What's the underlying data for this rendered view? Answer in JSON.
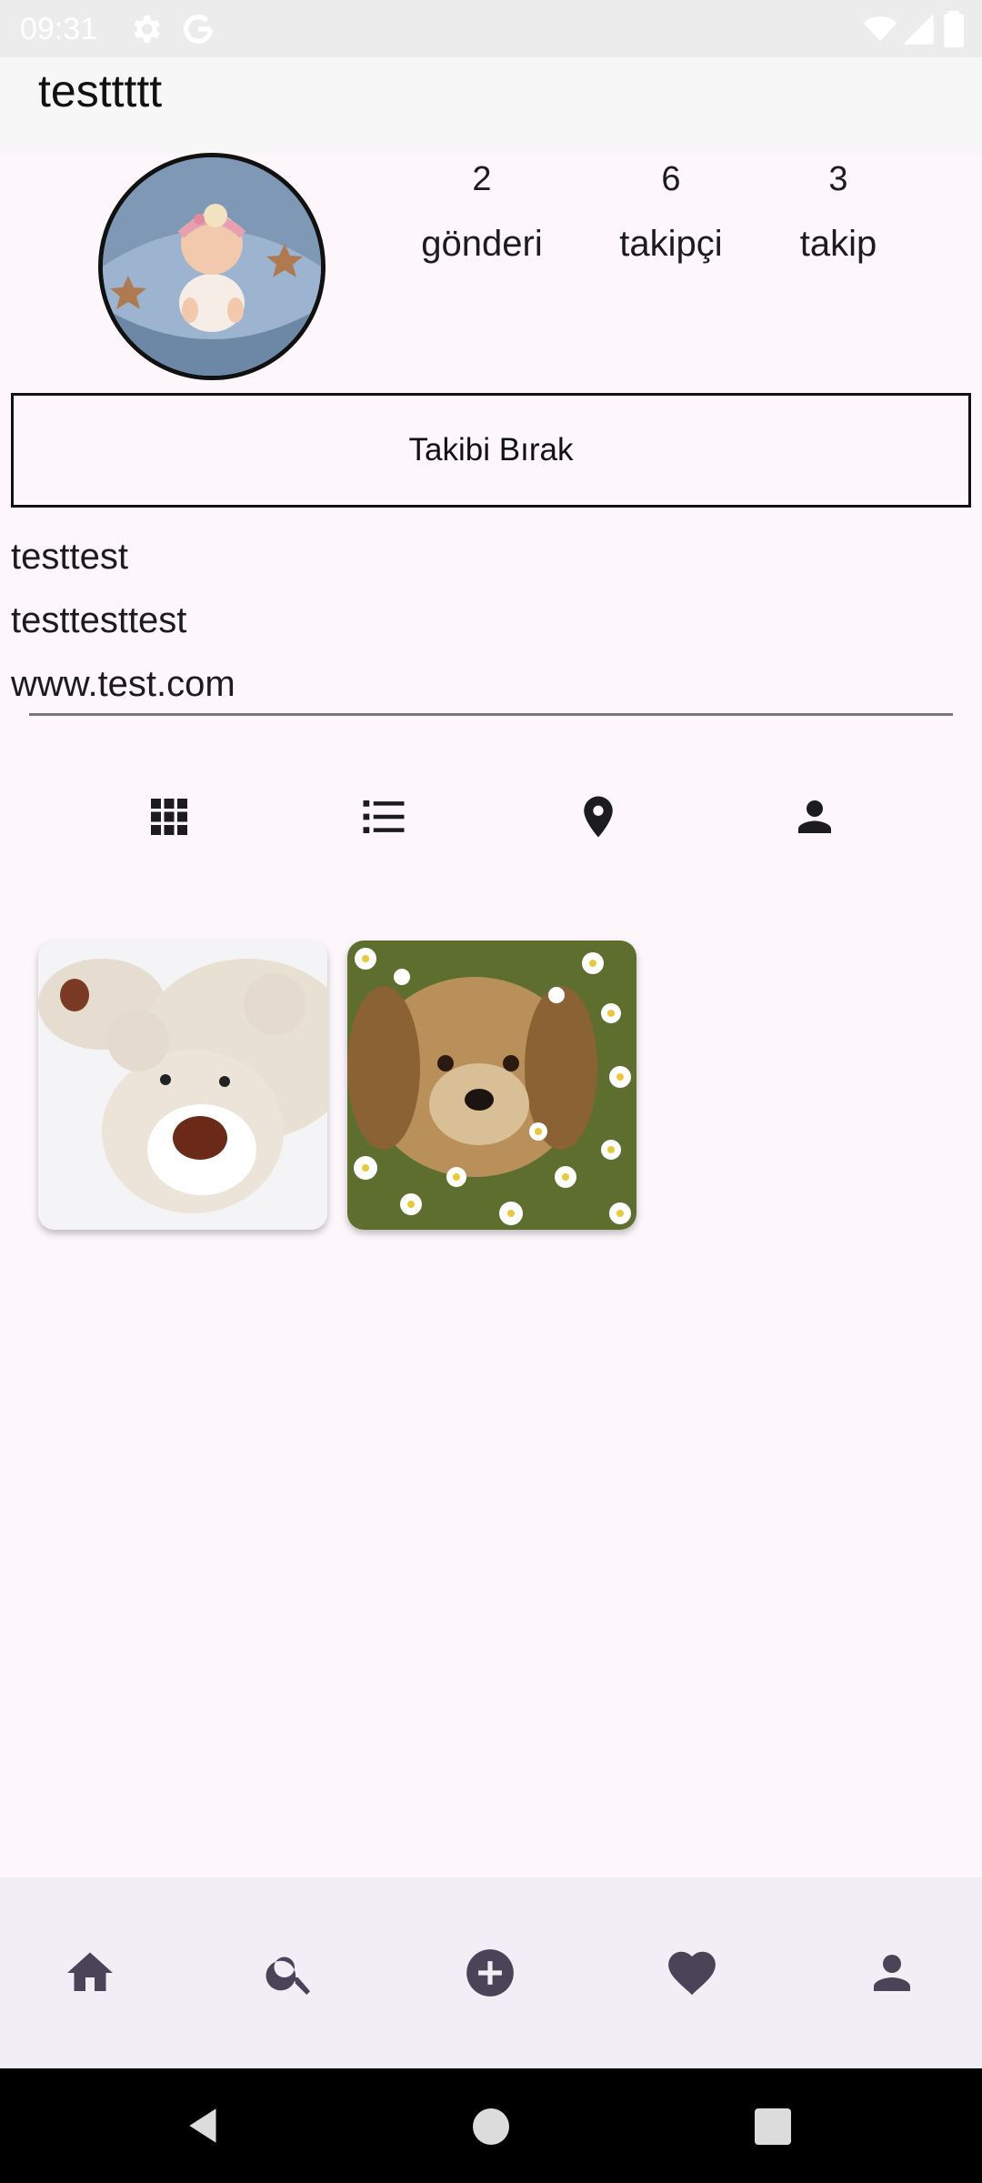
{
  "status_bar": {
    "time": "09:31",
    "icons": [
      "settings-icon",
      "google-icon",
      "wifi-icon",
      "signal-icon",
      "battery-icon"
    ]
  },
  "profile": {
    "username": "testtttt",
    "stats": [
      {
        "value": "2",
        "label": "gönderi"
      },
      {
        "value": "6",
        "label": "takipçi"
      },
      {
        "value": "3",
        "label": "takip"
      }
    ],
    "unfollow_label": "Takibi Bırak",
    "bio": {
      "name": "testtest",
      "description": "testtesttest",
      "website": "www.test.com"
    }
  },
  "tabs": [
    "grid-icon",
    "list-icon",
    "location-icon",
    "person-icon"
  ],
  "posts": [
    {
      "subject": "teddy bear"
    },
    {
      "subject": "dog in daisies"
    }
  ],
  "bottom_nav": [
    "home-icon",
    "search-icon",
    "add-circle-icon",
    "heart-icon",
    "person-icon"
  ],
  "colors": {
    "background": "#fdf7fb",
    "bottom_nav": "#f2eef6",
    "icon": "#1c1b1f"
  }
}
